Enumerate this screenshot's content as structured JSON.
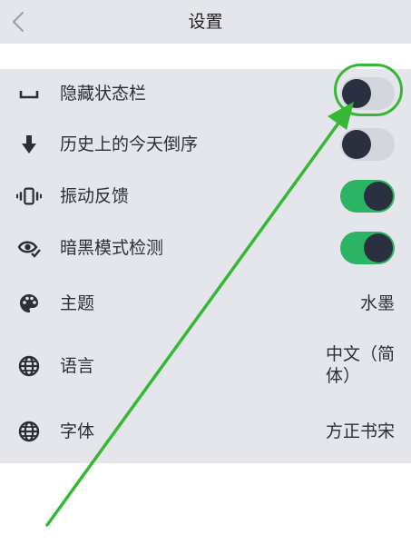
{
  "header": {
    "title": "设置",
    "back_icon": "chevron-left-icon"
  },
  "settings": [
    {
      "label": "隐藏状态栏",
      "icon": "space-bar-icon",
      "type": "toggle",
      "on": false
    },
    {
      "label": "历史上的今天倒序",
      "icon": "arrow-down-icon",
      "type": "toggle",
      "on": false
    },
    {
      "label": "振动反馈",
      "icon": "vibration-icon",
      "type": "toggle",
      "on": true
    },
    {
      "label": "暗黑模式检测",
      "icon": "eye-check-icon",
      "type": "toggle",
      "on": true
    },
    {
      "label": "主题",
      "icon": "palette-icon",
      "type": "value",
      "value": "水墨"
    },
    {
      "label": "语言",
      "icon": "globe-icon",
      "type": "value",
      "value_line1": "中文（简",
      "value_line2": "体）"
    },
    {
      "label": "字体",
      "icon": "globe-icon",
      "type": "value",
      "value": "方正书宋"
    }
  ],
  "colors": {
    "header_bg": "#e4e6eb",
    "list_bg": "#e4e6eb",
    "toggle_on": "#2bb463",
    "toggle_off": "#d3d6dc",
    "knob": "#2b3040",
    "annotation": "#36b836"
  }
}
